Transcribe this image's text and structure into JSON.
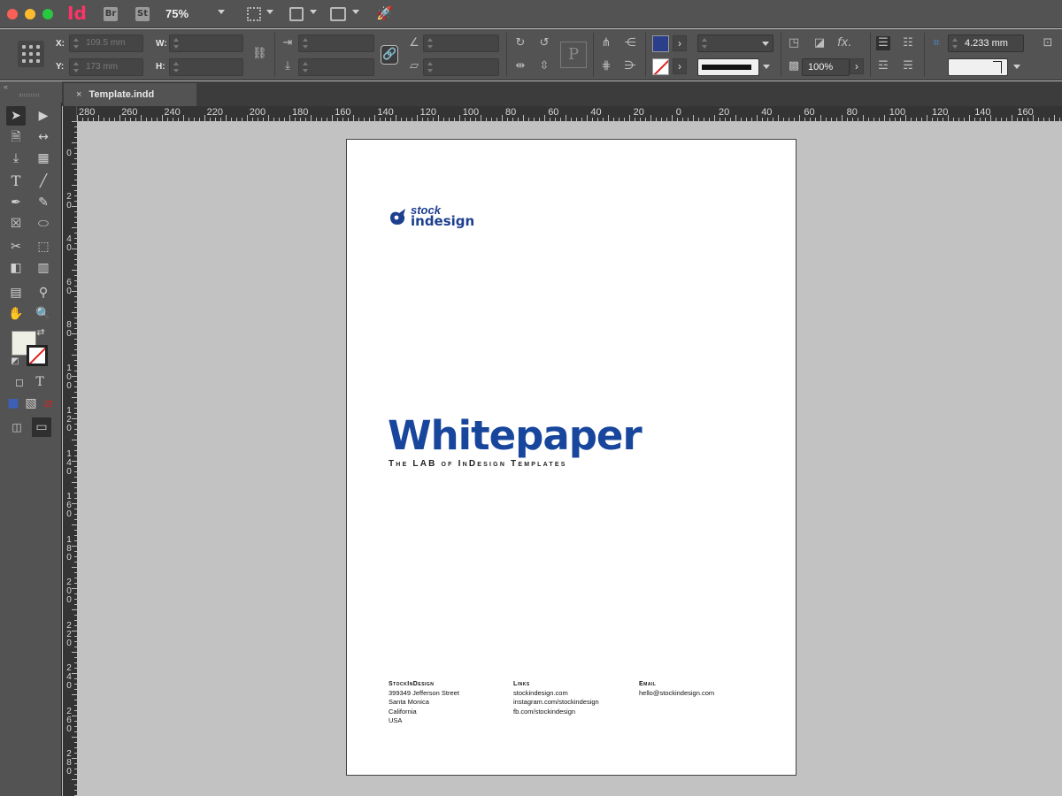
{
  "app": {
    "logo": "Id",
    "bridge_badge": "Br",
    "stock_badge": "St",
    "zoom": "75%"
  },
  "control": {
    "x_label": "X:",
    "y_label": "Y:",
    "w_label": "W:",
    "h_label": "H:",
    "x_value": "109.5 mm",
    "y_value": "173 mm",
    "w_value": "",
    "h_value": "",
    "opacity": "100%",
    "spacing": "4.233 mm",
    "p_label": "P",
    "fx_label": "fx.",
    "fill_color": "#2b3e8a"
  },
  "tab": {
    "close": "×",
    "name": "Template.indd"
  },
  "ruler": {
    "top": [
      "280",
      "260",
      "240",
      "220",
      "200",
      "180",
      "160",
      "140",
      "120",
      "100",
      "80",
      "60",
      "40",
      "20",
      "0",
      "20",
      "40",
      "60",
      "80",
      "100",
      "120",
      "140",
      "160"
    ],
    "left": [
      "0",
      "20",
      "40",
      "60",
      "80",
      "100",
      "120",
      "140",
      "160",
      "180",
      "200",
      "220",
      "240",
      "260",
      "280"
    ]
  },
  "document": {
    "logo_top": "stock",
    "logo_bottom": "indesign",
    "title": "Whitepaper",
    "subtitle": "The LAB of InDesign Templates",
    "footer": {
      "col1": {
        "heading": "StockInDesign",
        "lines": [
          "399349 Jefferson Street",
          "Santa Monica",
          "California",
          "USA"
        ]
      },
      "col2": {
        "heading": "Links",
        "lines": [
          "stockindesign.com",
          "instagram.com/stockindesign",
          "fb.com/stockindesign"
        ]
      },
      "col3": {
        "heading": "Email",
        "lines": [
          "hello@stockindesign.com"
        ]
      }
    }
  }
}
